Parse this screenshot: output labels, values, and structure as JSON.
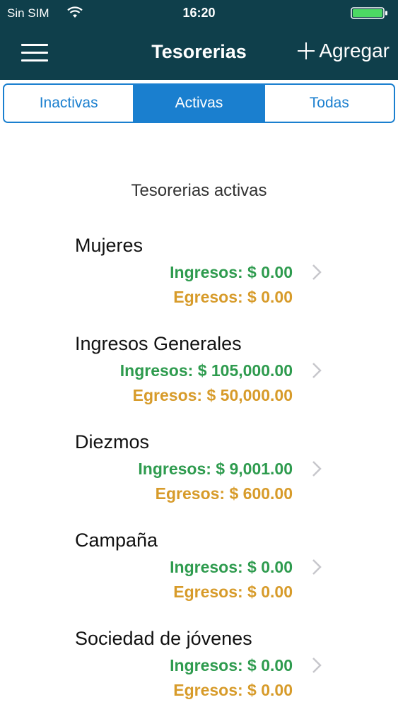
{
  "status_bar": {
    "carrier": "Sin SIM",
    "time": "16:20"
  },
  "nav": {
    "title": "Tesorerias",
    "add_label": "Agregar"
  },
  "tabs": [
    {
      "label": "Inactivas",
      "active": false
    },
    {
      "label": "Activas",
      "active": true
    },
    {
      "label": "Todas",
      "active": false
    }
  ],
  "section_title": "Tesorerias activas",
  "treasuries": [
    {
      "name": "Mujeres",
      "ingresos": "Ingresos: $ 0.00",
      "egresos": "Egresos: $ 0.00"
    },
    {
      "name": "Ingresos Generales",
      "ingresos": "Ingresos: $ 105,000.00",
      "egresos": "Egresos: $ 50,000.00"
    },
    {
      "name": "Diezmos",
      "ingresos": "Ingresos: $ 9,001.00",
      "egresos": "Egresos: $ 600.00"
    },
    {
      "name": "Campaña",
      "ingresos": "Ingresos: $ 0.00",
      "egresos": "Egresos: $ 0.00"
    },
    {
      "name": "Sociedad de jóvenes",
      "ingresos": "Ingresos: $ 0.00",
      "egresos": "Egresos: $ 0.00"
    }
  ],
  "colors": {
    "header_bg": "#0f3f4b",
    "accent": "#1a7fcf",
    "ingresos": "#2e9b4e",
    "egresos": "#d79b2a"
  },
  "icons": {
    "menu": "menu-icon",
    "add": "plus-icon",
    "chevron": "chevron-right-icon",
    "wifi": "wifi-icon",
    "battery": "battery-icon"
  }
}
